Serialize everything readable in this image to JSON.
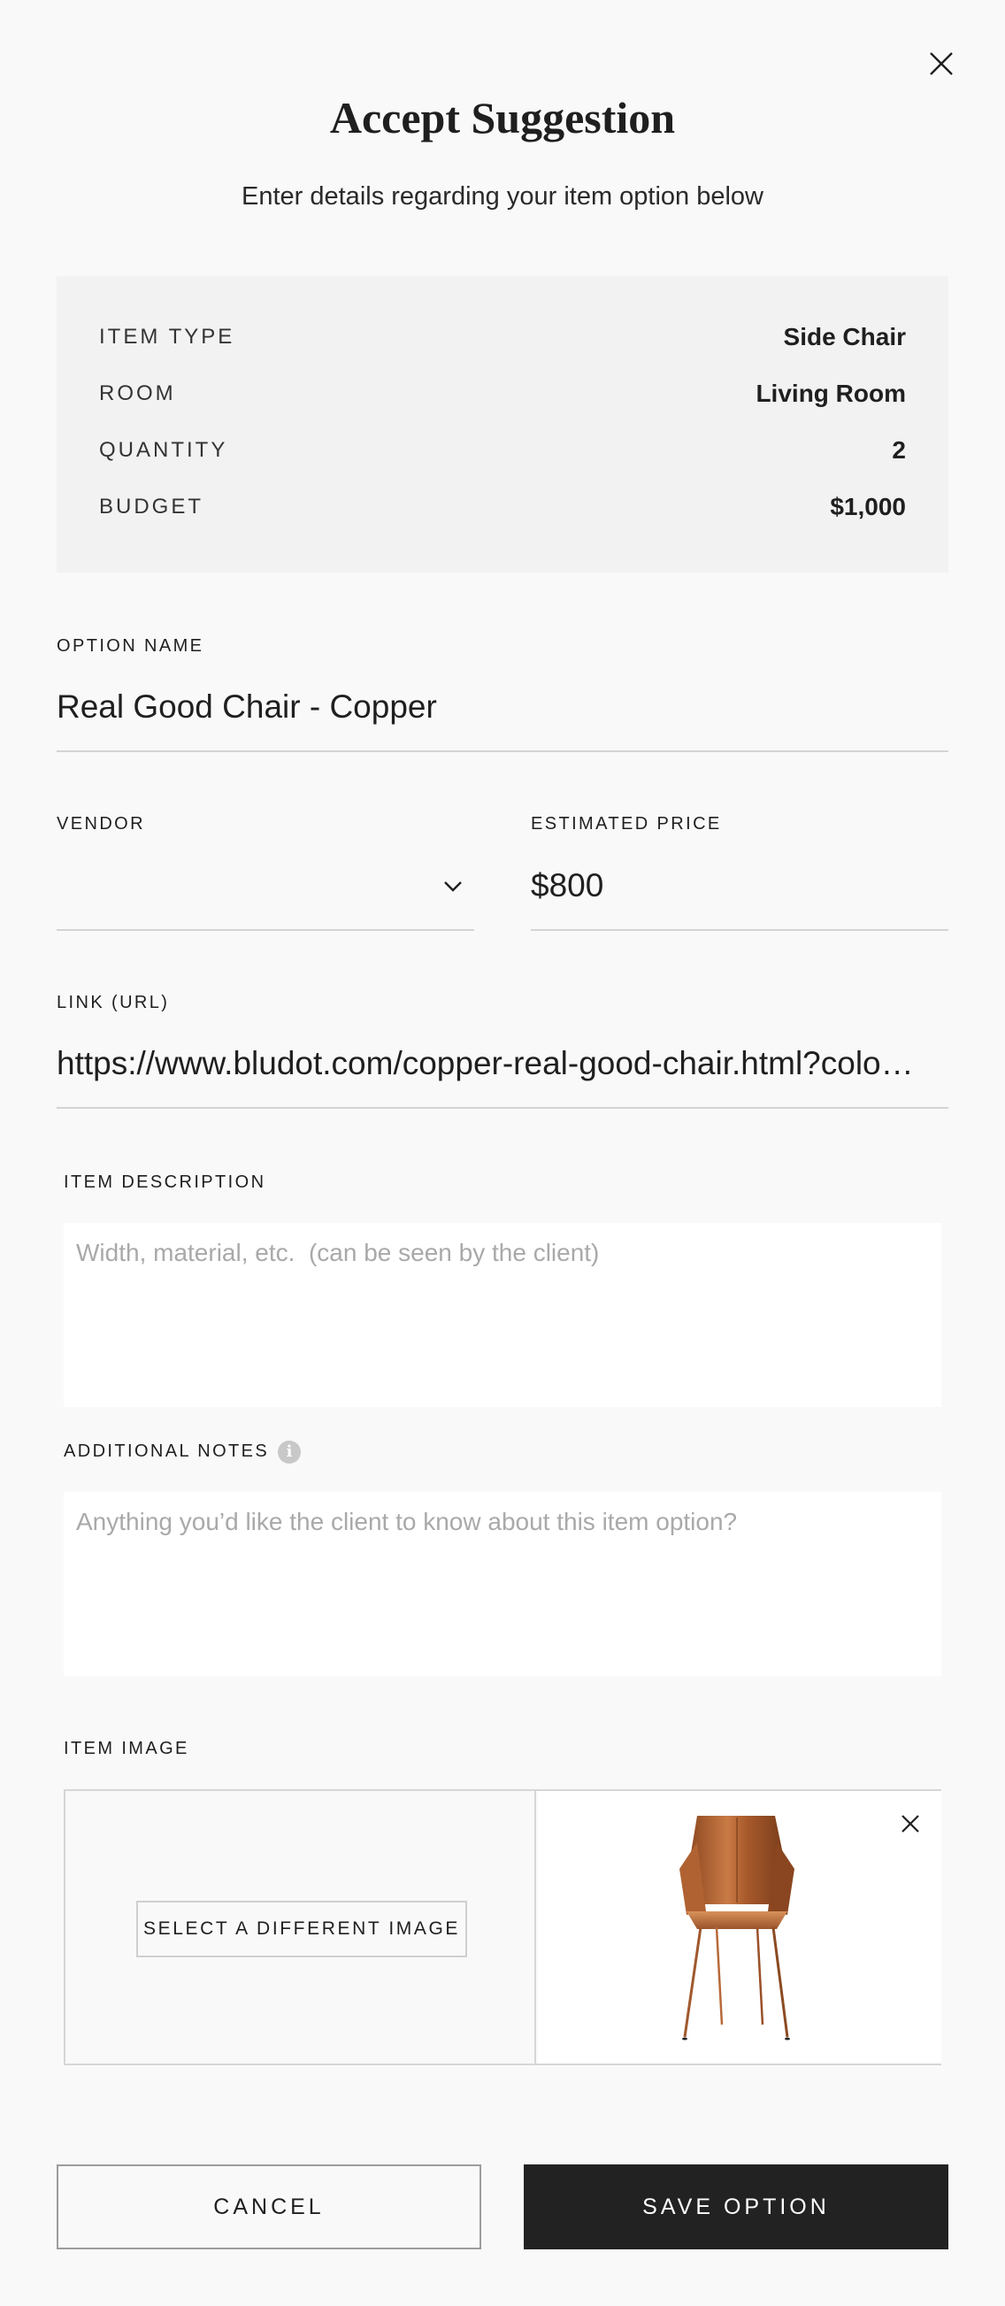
{
  "modal": {
    "title": "Accept Suggestion",
    "subtitle": "Enter details regarding your item option below"
  },
  "summary": [
    {
      "key": "ITEM TYPE",
      "value": "Side Chair"
    },
    {
      "key": "ROOM",
      "value": "Living Room"
    },
    {
      "key": "QUANTITY",
      "value": "2"
    },
    {
      "key": "BUDGET",
      "value": "$1,000"
    }
  ],
  "form": {
    "option_name": {
      "label": "OPTION NAME",
      "value": "Real Good Chair - Copper"
    },
    "vendor": {
      "label": "VENDOR",
      "value": ""
    },
    "estimated_price": {
      "label": "ESTIMATED PRICE",
      "value": "$800"
    },
    "link": {
      "label": "LINK (URL)",
      "value": "https://www.bludot.com/copper-real-good-chair.html?colo…"
    },
    "item_description": {
      "label": "ITEM DESCRIPTION",
      "placeholder": "Width, material, etc.  (can be seen by the client)"
    },
    "additional_notes": {
      "label": "ADDITIONAL NOTES",
      "placeholder": "Anything you’d like the client to know about this item option?",
      "info_icon": "i"
    },
    "item_image": {
      "label": "ITEM IMAGE",
      "select_button": "SELECT A DIFFERENT IMAGE"
    }
  },
  "actions": {
    "cancel": "CANCEL",
    "save": "SAVE OPTION"
  },
  "icons": {
    "close": "close-icon",
    "vendor_dropdown": "chevron-down-icon",
    "info": "info-icon",
    "remove_image": "close-icon"
  },
  "colors": {
    "background": "#f9f9f9",
    "summary_bg": "#f2f2f2",
    "primary_button": "#222222",
    "copper": "#b8693a"
  }
}
